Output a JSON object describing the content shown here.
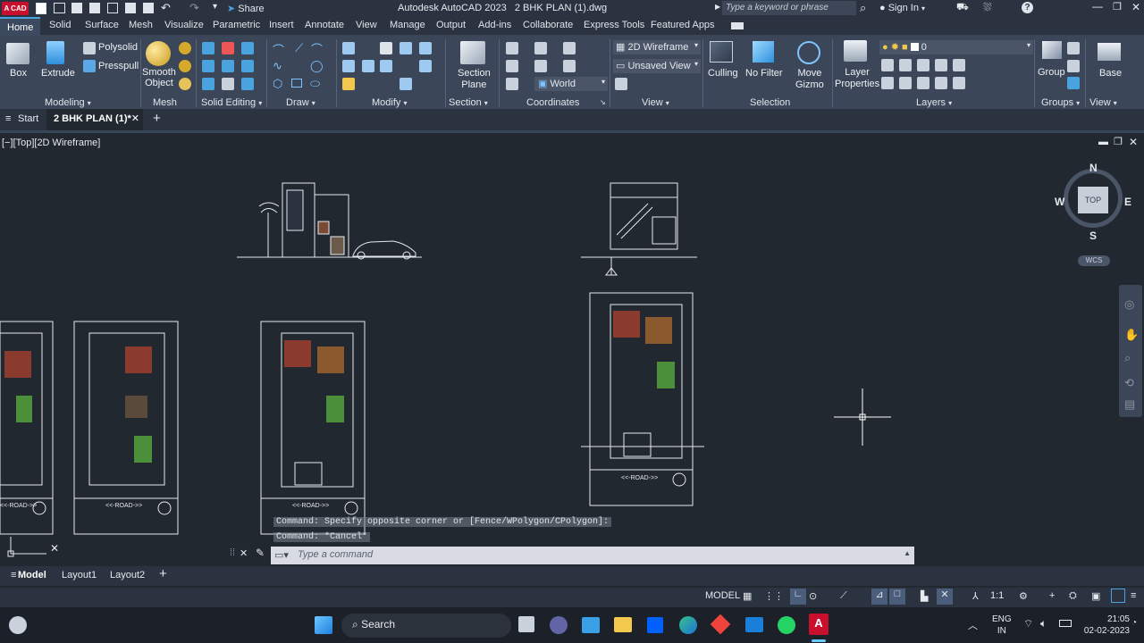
{
  "title_bar": {
    "app_badge": "A CAD",
    "title": "Autodesk AutoCAD 2023   2 BHK PLAN (1).dwg",
    "share": "Share",
    "search_placeholder": "Type a keyword or phrase",
    "sign_in": "Sign In"
  },
  "menu_tabs": [
    "Home",
    "Solid",
    "Surface",
    "Mesh",
    "Visualize",
    "Parametric",
    "Insert",
    "Annotate",
    "View",
    "Manage",
    "Output",
    "Add-ins",
    "Collaborate",
    "Express Tools",
    "Featured Apps"
  ],
  "ribbon": {
    "box": "Box",
    "extrude": "Extrude",
    "polysolid": "Polysolid",
    "presspull": "Presspull",
    "smooth_object_1": "Smooth",
    "smooth_object_2": "Object",
    "section_plane_1": "Section",
    "section_plane_2": "Plane",
    "visual_style": "2D Wireframe",
    "view_state": "Unsaved View",
    "ucs": "World",
    "culling": "Culling",
    "no_filter": "No Filter",
    "move_gizmo_1": "Move",
    "move_gizmo_2": "Gizmo",
    "layer_props_1": "Layer",
    "layer_props_2": "Properties",
    "layer_value": "0",
    "group": "Group",
    "base": "Base",
    "panels": {
      "modeling": "Modeling",
      "mesh": "Mesh",
      "solid_editing": "Solid Editing",
      "draw": "Draw",
      "modify": "Modify",
      "section": "Section",
      "coordinates": "Coordinates",
      "view": "View",
      "selection": "Selection",
      "layers": "Layers",
      "groups": "Groups",
      "view2": "View"
    }
  },
  "file_tabs": {
    "start": "Start",
    "active": "2 BHK PLAN (1)*"
  },
  "viewport_label": "[−][Top][2D Wireframe]",
  "viewcube": {
    "n": "N",
    "s": "S",
    "e": "E",
    "w": "W",
    "top": "TOP",
    "wcs": "WCS"
  },
  "drawing": {
    "road_label": "<<-ROAD->>"
  },
  "command": {
    "history_1": "Command: Specify opposite corner or [Fence/WPolygon/CPolygon]:",
    "history_2": "Command: *Cancel*",
    "placeholder": "Type a command"
  },
  "layout_tabs": [
    "Model",
    "Layout1",
    "Layout2"
  ],
  "status": {
    "model": "MODEL",
    "scale": "1:1"
  },
  "taskbar": {
    "search": "Search",
    "lang_1": "ENG",
    "lang_2": "IN",
    "time": "21:05",
    "date": "02-02-2023"
  },
  "colors": {
    "accent": "#4aa3df",
    "autocad_red": "#c8102e",
    "canvas": "#212830",
    "ribbon": "#3b4658"
  }
}
